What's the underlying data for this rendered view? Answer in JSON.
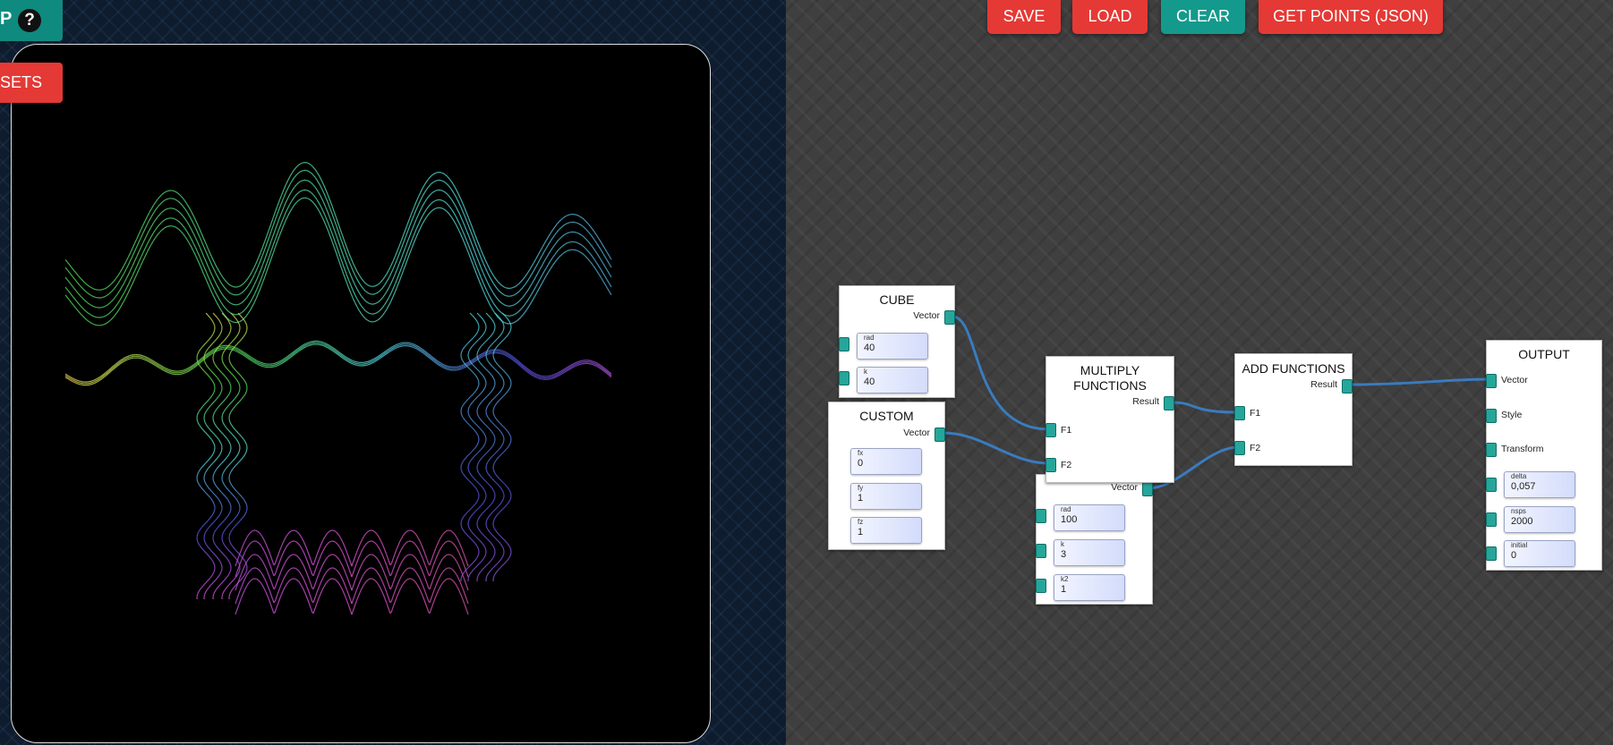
{
  "top_chip": {
    "partial_label": "P",
    "help_icon": "?"
  },
  "presets_button": "SETS",
  "toolbar": {
    "save": "SAVE",
    "load": "LOAD",
    "clear": "CLEAR",
    "get_points": "GET POINTS (JSON)"
  },
  "nodes": {
    "cube": {
      "title": "CUBE",
      "output": "Vector",
      "rad_label": "rad",
      "rad": "40",
      "k_label": "k",
      "k": "40"
    },
    "custom": {
      "title": "CUSTOM",
      "output": "Vector",
      "fx_label": "fx",
      "fx": "0",
      "fy_label": "fy",
      "fy": "1",
      "fz_label": "fz",
      "fz": "1"
    },
    "multiply": {
      "title_line1": "MULTIPLY",
      "title_line2": "FUNCTIONS",
      "output": "Result",
      "in1": "F1",
      "in2": "F2"
    },
    "lower": {
      "output": "Vector",
      "rad_label": "rad",
      "rad": "100",
      "k_label": "k",
      "k": "3",
      "k2_label": "k2",
      "k2": "1"
    },
    "add": {
      "title": "ADD FUNCTIONS",
      "output": "Result",
      "in1": "F1",
      "in2": "F2"
    },
    "output": {
      "title": "OUTPUT",
      "in_vector": "Vector",
      "in_style": "Style",
      "in_transform": "Transform",
      "delta_label": "delta",
      "delta": "0,057",
      "nsps_label": "nsps",
      "nsps": "2000",
      "initial_label": "initial",
      "initial": "0"
    }
  },
  "colors": {
    "accent_red": "#e53935",
    "accent_teal": "#139a8c",
    "port": "#26a69a",
    "wire": "#3a7bbf"
  }
}
